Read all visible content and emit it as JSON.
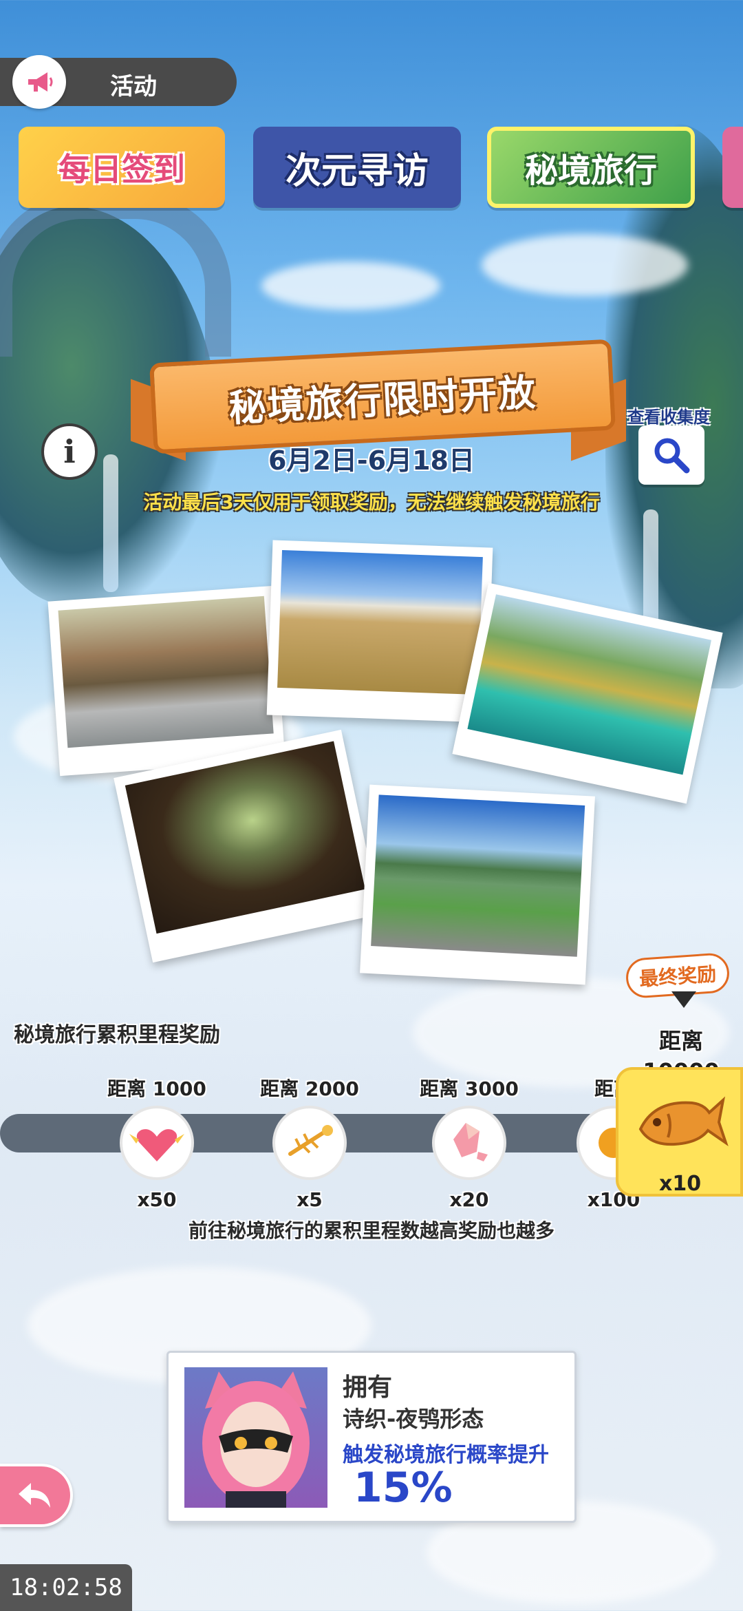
{
  "topbar": {
    "title": "活动",
    "icon": "megaphone-icon"
  },
  "tabs": [
    {
      "label": "每日签到",
      "selected": false
    },
    {
      "label": "次元寻访",
      "selected": false
    },
    {
      "label": "秘境旅行",
      "selected": true
    },
    {
      "label": "",
      "selected": false
    }
  ],
  "event": {
    "title": "秘境旅行限时开放",
    "date_range": "6月2日-6月18日",
    "notice": "活动最后3天仅用于领取奖励，无法继续触发秘境旅行",
    "collection_label": "查看收集度"
  },
  "rewards": {
    "title": "秘境旅行累积里程奖励",
    "final_tag": "最终奖励",
    "milestones": [
      {
        "label": "距离 1000",
        "qty": "x50",
        "icon": "winged-heart-icon"
      },
      {
        "label": "距离 2000",
        "qty": "x5",
        "icon": "fish-bone-icon"
      },
      {
        "label": "距离 3000",
        "qty": "x20",
        "icon": "pink-crystal-icon"
      },
      {
        "label": "距离",
        "qty": "x100",
        "icon": "orange-item-icon"
      }
    ],
    "final": {
      "label_line1": "距离",
      "label_line2": "10000",
      "qty": "x10",
      "icon": "golden-fish-icon"
    },
    "footnote": "前往秘境旅行的累积里程数越高奖励也越多"
  },
  "buff": {
    "own_label": "拥有",
    "character": "诗织-夜鸮形态",
    "description": "触发秘境旅行概率提升",
    "value": "15%"
  },
  "clock": "18:02:58",
  "colors": {
    "accent_blue": "#2a47c8",
    "orange": "#f39a3a",
    "back_pink": "#f27898"
  }
}
